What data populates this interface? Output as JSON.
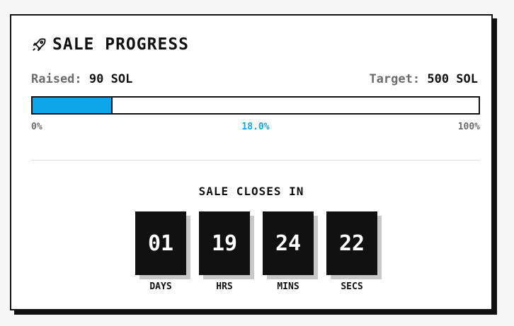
{
  "header": {
    "icon": "rocket-icon",
    "title": "SALE PROGRESS"
  },
  "funding": {
    "raised_label": "Raised:",
    "raised_value": "90 SOL",
    "target_label": "Target:",
    "target_value": "500 SOL",
    "progress_fraction": 0.18,
    "scale_min": "0%",
    "progress_text": "18.0%",
    "scale_max": "100%"
  },
  "countdown": {
    "heading": "SALE CLOSES IN",
    "units": [
      {
        "value": "01",
        "label": "DAYS"
      },
      {
        "value": "19",
        "label": "HRS"
      },
      {
        "value": "24",
        "label": "MINS"
      },
      {
        "value": "22",
        "label": "SECS"
      }
    ]
  },
  "colors": {
    "accent": "#0ea5e9",
    "ink": "#111111",
    "muted": "#6b6b6b"
  }
}
